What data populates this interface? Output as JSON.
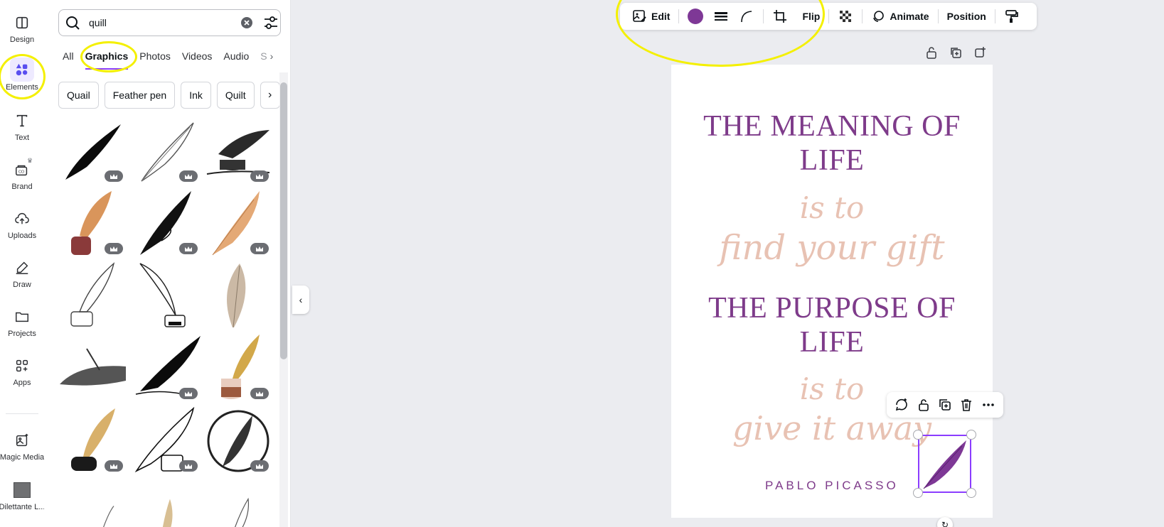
{
  "rail": {
    "items": [
      {
        "label": "Design",
        "icon": "layout-icon"
      },
      {
        "label": "Elements",
        "icon": "shapes-icon"
      },
      {
        "label": "Text",
        "icon": "text-t-icon"
      },
      {
        "label": "Brand",
        "icon": "brand-kit-icon"
      },
      {
        "label": "Uploads",
        "icon": "cloud-upload-icon"
      },
      {
        "label": "Draw",
        "icon": "pen-draw-icon"
      },
      {
        "label": "Projects",
        "icon": "folder-icon"
      },
      {
        "label": "Apps",
        "icon": "apps-grid-icon"
      },
      {
        "label": "Magic Media",
        "icon": "magic-media-icon"
      },
      {
        "label": "Dilettante L..."
      }
    ],
    "active": "Elements"
  },
  "panel": {
    "search_value": "quill",
    "tabs": [
      "All",
      "Graphics",
      "Photos",
      "Videos",
      "Audio",
      "S"
    ],
    "active_tab": "Graphics",
    "chips": [
      "Quail",
      "Feather pen",
      "Ink",
      "Quilt"
    ]
  },
  "toolbar": {
    "edit_label": "Edit",
    "flip_label": "Flip",
    "animate_label": "Animate",
    "position_label": "Position",
    "swatch_color": "#7e3896"
  },
  "canvas": {
    "heading1_line1": "THE MEANING OF",
    "heading1_line2": "LIFE",
    "script1_line1": "is to",
    "script1_line2": "find your gift",
    "heading2_line1": "THE PURPOSE OF",
    "heading2_line2": "LIFE",
    "script2_line1": "is to",
    "script2_line2": "give it away",
    "author": "PABLO PICASSO",
    "heading_color": "#7e3b8a",
    "script_color": "#e8c2b3"
  },
  "colors": {
    "accent": "#8b3dff",
    "annotation": "#f4f000"
  }
}
